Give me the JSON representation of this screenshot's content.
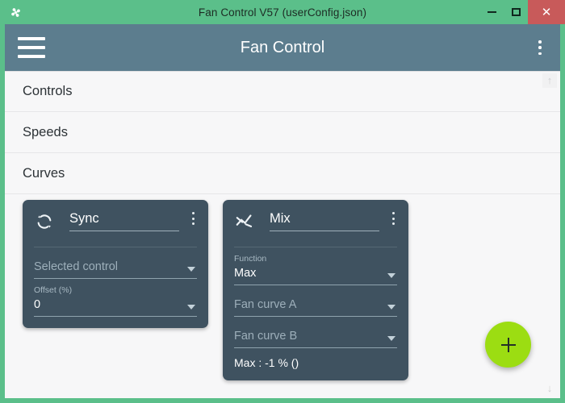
{
  "window": {
    "title": "Fan Control V57 (userConfig.json)",
    "app_icon": "fan-icon",
    "colors": {
      "frame_green": "#5BBF8A",
      "appbar": "#5C7D8E",
      "card": "#3F5260",
      "content_bg": "#F7F7F8",
      "close_red": "#C85A5A",
      "fab_green": "#9CDD12"
    },
    "controls": {
      "minimize": "minimize-icon",
      "maximize": "maximize-icon",
      "close": "✕"
    }
  },
  "appbar": {
    "menu_icon": "hamburger-icon",
    "title": "Fan Control",
    "overflow_icon": "more-vertical-icon"
  },
  "sections": [
    {
      "label": "Controls"
    },
    {
      "label": "Speeds"
    },
    {
      "label": "Curves"
    }
  ],
  "cards": [
    {
      "id": "sync",
      "icon": "sync-icon",
      "title": "Sync",
      "overflow_icon": "more-vertical-icon",
      "fields": [
        {
          "label": "",
          "value": "Selected control",
          "is_placeholder": true
        },
        {
          "label": "Offset (%)",
          "value": "0",
          "is_placeholder": false
        }
      ]
    },
    {
      "id": "mix",
      "icon": "mix-curve-icon",
      "title": "Mix",
      "overflow_icon": "more-vertical-icon",
      "fields": [
        {
          "label": "Function",
          "value": "Max",
          "is_placeholder": false
        },
        {
          "label": "",
          "value": "Fan curve A",
          "is_placeholder": true
        },
        {
          "label": "",
          "value": "Fan curve B",
          "is_placeholder": true
        }
      ],
      "status": "Max : -1 % ()"
    }
  ],
  "fab": {
    "label": "+",
    "icon": "plus-icon"
  },
  "scroll": {
    "up": "↑",
    "down": "↓"
  }
}
